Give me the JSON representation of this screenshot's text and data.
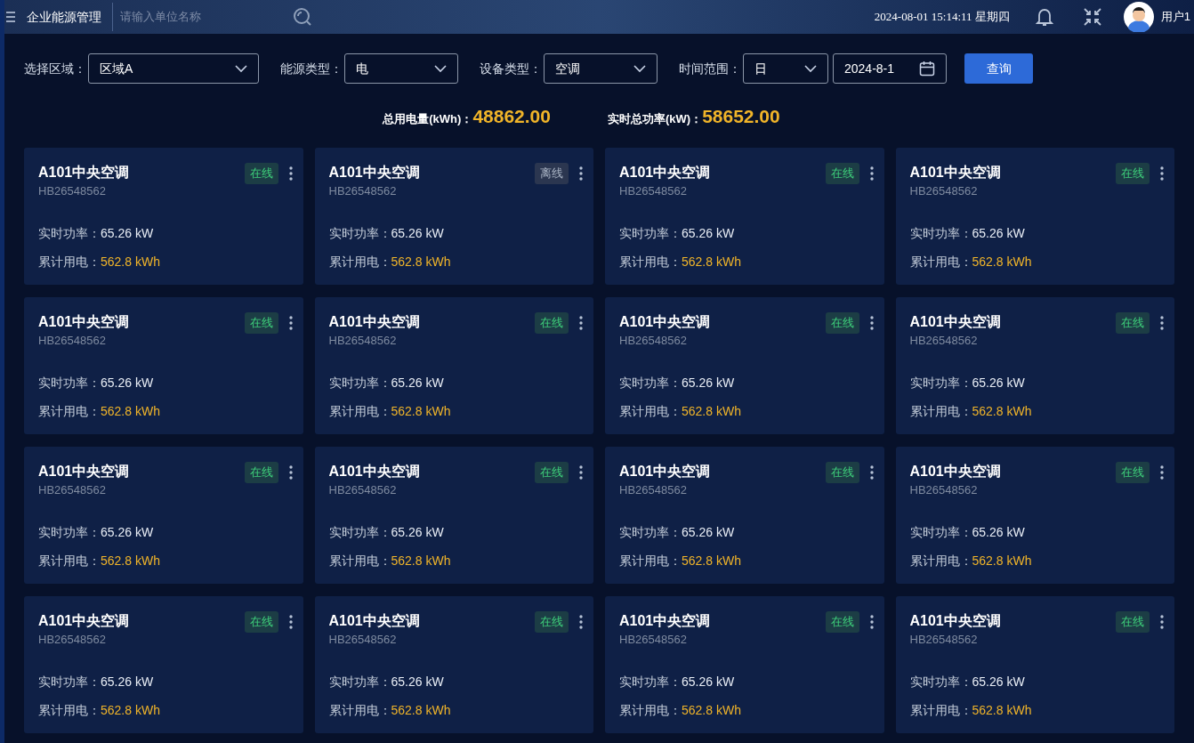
{
  "header": {
    "title": "企业能源管理",
    "search": {
      "placeholder": "请输入单位名称"
    },
    "datetime": "2024-08-01 15:14:11 星期四",
    "user": "用户1"
  },
  "filters": [
    {
      "kind": "select",
      "label": "选择区域：",
      "value": "区域A"
    },
    {
      "kind": "select",
      "label": "能源类型：",
      "value": "电"
    },
    {
      "kind": "select",
      "label": "设备类型：",
      "value": "空调"
    },
    {
      "kind": "select",
      "label": "时间范围：",
      "value": "日"
    },
    {
      "kind": "date",
      "value": "2024-8-1"
    }
  ],
  "query_button": "查询",
  "totals": [
    {
      "label": "总用电量(kWh)：",
      "value": "48862.00"
    },
    {
      "label": "实时总功率(kW)：",
      "value": "58652.00"
    }
  ],
  "devices": [
    {
      "name": "A101中央空调",
      "code": "HB26548562",
      "status": "在线",
      "online": true,
      "power_label": "实时功率：",
      "power": "65.26 kW",
      "energy_label": "累计用电：",
      "energy": "562.8 kWh"
    },
    {
      "name": "A101中央空调",
      "code": "HB26548562",
      "status": "离线",
      "online": false,
      "power_label": "实时功率：",
      "power": "65.26 kW",
      "energy_label": "累计用电：",
      "energy": "562.8 kWh"
    },
    {
      "name": "A101中央空调",
      "code": "HB26548562",
      "status": "在线",
      "online": true,
      "power_label": "实时功率：",
      "power": "65.26 kW",
      "energy_label": "累计用电：",
      "energy": "562.8 kWh"
    },
    {
      "name": "A101中央空调",
      "code": "HB26548562",
      "status": "在线",
      "online": true,
      "power_label": "实时功率：",
      "power": "65.26 kW",
      "energy_label": "累计用电：",
      "energy": "562.8 kWh"
    },
    {
      "name": "A101中央空调",
      "code": "HB26548562",
      "status": "在线",
      "online": true,
      "power_label": "实时功率：",
      "power": "65.26 kW",
      "energy_label": "累计用电：",
      "energy": "562.8 kWh"
    },
    {
      "name": "A101中央空调",
      "code": "HB26548562",
      "status": "在线",
      "online": true,
      "power_label": "实时功率：",
      "power": "65.26 kW",
      "energy_label": "累计用电：",
      "energy": "562.8 kWh"
    },
    {
      "name": "A101中央空调",
      "code": "HB26548562",
      "status": "在线",
      "online": true,
      "power_label": "实时功率：",
      "power": "65.26 kW",
      "energy_label": "累计用电：",
      "energy": "562.8 kWh"
    },
    {
      "name": "A101中央空调",
      "code": "HB26548562",
      "status": "在线",
      "online": true,
      "power_label": "实时功率：",
      "power": "65.26 kW",
      "energy_label": "累计用电：",
      "energy": "562.8 kWh"
    },
    {
      "name": "A101中央空调",
      "code": "HB26548562",
      "status": "在线",
      "online": true,
      "power_label": "实时功率：",
      "power": "65.26 kW",
      "energy_label": "累计用电：",
      "energy": "562.8 kWh"
    },
    {
      "name": "A101中央空调",
      "code": "HB26548562",
      "status": "在线",
      "online": true,
      "power_label": "实时功率：",
      "power": "65.26 kW",
      "energy_label": "累计用电：",
      "energy": "562.8 kWh"
    },
    {
      "name": "A101中央空调",
      "code": "HB26548562",
      "status": "在线",
      "online": true,
      "power_label": "实时功率：",
      "power": "65.26 kW",
      "energy_label": "累计用电：",
      "energy": "562.8 kWh"
    },
    {
      "name": "A101中央空调",
      "code": "HB26548562",
      "status": "在线",
      "online": true,
      "power_label": "实时功率：",
      "power": "65.26 kW",
      "energy_label": "累计用电：",
      "energy": "562.8 kWh"
    },
    {
      "name": "A101中央空调",
      "code": "HB26548562",
      "status": "在线",
      "online": true,
      "power_label": "实时功率：",
      "power": "65.26 kW",
      "energy_label": "累计用电：",
      "energy": "562.8 kWh"
    },
    {
      "name": "A101中央空调",
      "code": "HB26548562",
      "status": "在线",
      "online": true,
      "power_label": "实时功率：",
      "power": "65.26 kW",
      "energy_label": "累计用电：",
      "energy": "562.8 kWh"
    },
    {
      "name": "A101中央空调",
      "code": "HB26548562",
      "status": "在线",
      "online": true,
      "power_label": "实时功率：",
      "power": "65.26 kW",
      "energy_label": "累计用电：",
      "energy": "562.8 kWh"
    },
    {
      "name": "A101中央空调",
      "code": "HB26548562",
      "status": "在线",
      "online": true,
      "power_label": "实时功率：",
      "power": "65.26 kW",
      "energy_label": "累计用电：",
      "energy": "562.8 kWh"
    }
  ]
}
